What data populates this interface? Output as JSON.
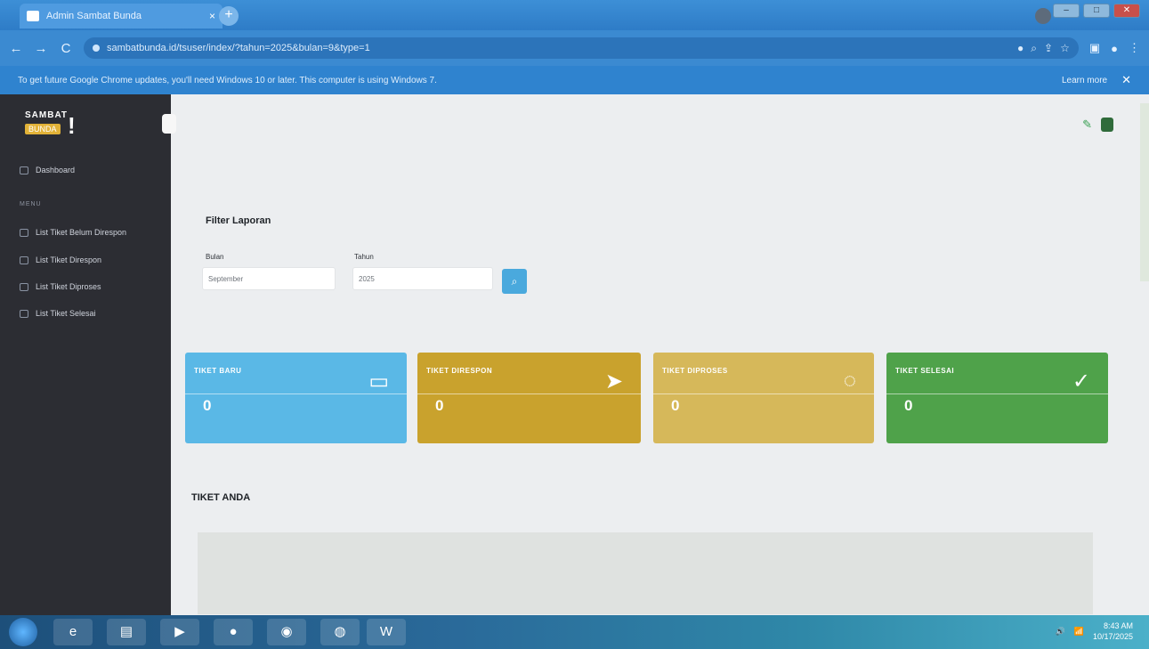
{
  "browser": {
    "tab_title": "Admin Sambat Bunda",
    "tab_close": "×",
    "new_tab": "+",
    "url": "sambatbunda.id/tsuser/index/?tahun=2025&bulan=9&type=1",
    "infobar_text": "To get future Google Chrome updates, you'll need Windows 10 or later. This computer is using Windows 7.",
    "infobar_learn_more": "Learn more",
    "infobar_close": "✕",
    "back_icon": "←",
    "forward_icon": "→",
    "reload_icon": "C"
  },
  "sidebar": {
    "logo_top": "SAMBAT",
    "logo_bottom": "BUNDA",
    "logo_bang": "!",
    "dashboard": "Dashboard",
    "menu_label": "MENU",
    "items": [
      {
        "label": "List Tiket Belum Direspon"
      },
      {
        "label": "List Tiket Direspon"
      },
      {
        "label": "List Tiket Diproses"
      },
      {
        "label": "List Tiket Selesai"
      }
    ]
  },
  "filter": {
    "title": "Filter Laporan",
    "month_label": "Bulan",
    "month_value": "September",
    "year_label": "Tahun",
    "year_value": "2025",
    "submit_icon": "⌕"
  },
  "cards": [
    {
      "label": "TIKET BARU",
      "value": "0",
      "color": "#5ab8e6",
      "icon": "inbox-icon"
    },
    {
      "label": "TIKET DIRESPON",
      "value": "0",
      "color": "#c9a22d",
      "icon": "send-icon"
    },
    {
      "label": "TIKET DIPROSES",
      "value": "0",
      "color": "#d6b85a",
      "icon": "spinner-icon"
    },
    {
      "label": "TIKET SELESAI",
      "value": "0",
      "color": "#4fa24a",
      "icon": "check-icon"
    }
  ],
  "section": {
    "title": "TIKET ANDA"
  },
  "taskbar": {
    "time": "8:43 AM",
    "date": "10/17/2025"
  }
}
